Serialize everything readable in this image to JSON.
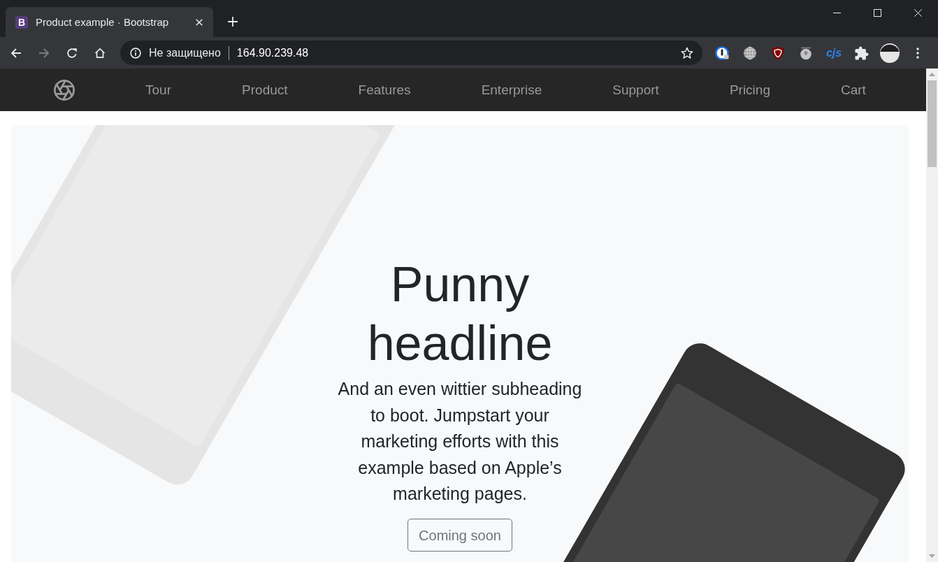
{
  "browser": {
    "tab": {
      "favicon_letter": "B",
      "title": "Product example · Bootstrap",
      "selected": true
    },
    "forward": {
      "disabled": true
    },
    "address_bar": {
      "security_label": "Не защищено",
      "url": "164.90.239.48"
    },
    "extension_label": "cjs"
  },
  "site_nav": {
    "links": [
      "Tour",
      "Product",
      "Features",
      "Enterprise",
      "Support",
      "Pricing",
      "Cart"
    ]
  },
  "hero": {
    "headline": "Punny headline",
    "subheading": "And an even wittier subheading to boot. Jumpstart your marketing efforts with this example based on Apple’s marketing pages.",
    "button_label": "Coming soon"
  }
}
